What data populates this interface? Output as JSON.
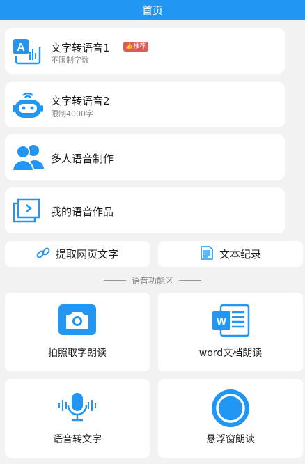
{
  "header": {
    "title": "首页"
  },
  "menu": [
    {
      "title": "文字转语音1",
      "subtitle": "不限制字数",
      "badge": "推荐",
      "icon": "tts-translate-icon"
    },
    {
      "title": "文字转语音2",
      "subtitle": "限制4000字",
      "icon": "robot-icon"
    },
    {
      "title": "多人语音制作",
      "icon": "users-icon"
    },
    {
      "title": "我的语音作品",
      "icon": "works-folder-icon"
    }
  ],
  "quick": [
    {
      "label": "提取网页文字",
      "icon": "link-icon"
    },
    {
      "label": "文本纪录",
      "icon": "document-list-icon"
    }
  ],
  "section": {
    "title": "语音功能区"
  },
  "tiles": [
    {
      "label": "拍照取字朗读",
      "icon": "camera-icon"
    },
    {
      "label": "word文档朗读",
      "icon": "word-icon"
    },
    {
      "label": "语音转文字",
      "icon": "microphone-icon"
    },
    {
      "label": "悬浮窗朗读",
      "icon": "floating-circle-icon"
    }
  ],
  "colors": {
    "primary": "#2196f3",
    "badge": "#e05a5a",
    "background": "#f2f2f2"
  }
}
